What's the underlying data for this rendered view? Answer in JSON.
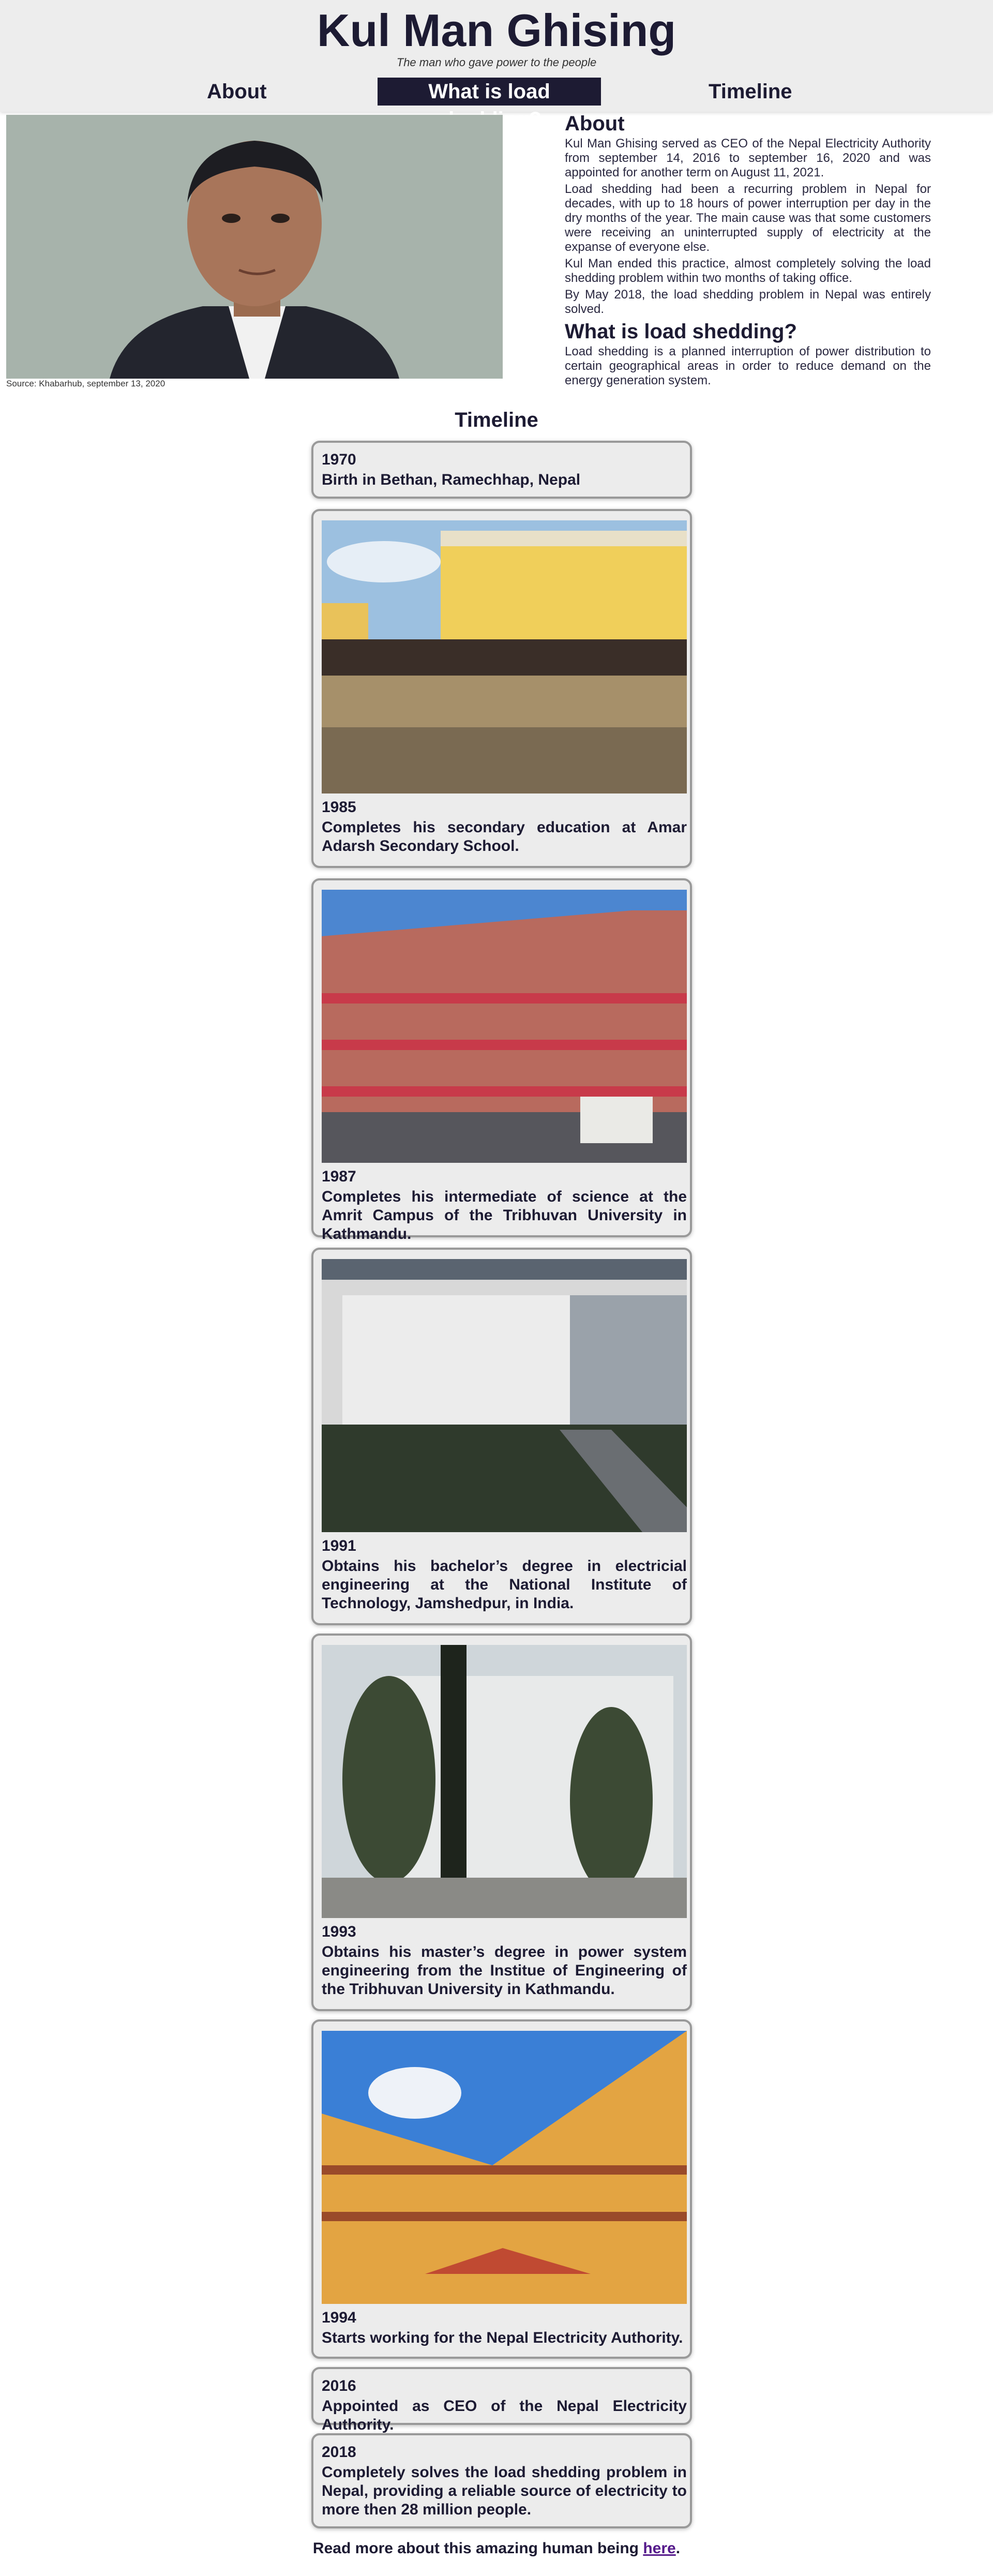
{
  "header": {
    "title": "Kul Man Ghising",
    "tagline": "The man who gave power to the people",
    "nav": [
      "About",
      "What is load shedding?",
      "Timeline"
    ]
  },
  "hero": {
    "caption": "Source: Khabarhub, september 13, 2020"
  },
  "about": {
    "heading": "About",
    "paragraphs": [
      "Kul Man Ghising served as CEO of the Nepal Electricity Authority from september 14, 2016 to september 16, 2020 and was appointed for another term on August 11, 2021.",
      "Load shedding had been a recurring problem in Nepal for decades, with up to 18 hours of power interruption per day in the dry months of the year. The main cause was that some customers were receiving an uninterrupted supply of electricity at the expanse of everyone else.",
      "Kul Man ended this practice, almost completely solving the load shedding problem within two months of taking office.",
      "By May 2018, the load shedding problem in Nepal was entirely solved."
    ],
    "load_heading": "What is load shedding?",
    "load_paragraph": "Load shedding is a planned interruption of power distribution to certain geographical areas in order to reduce demand on the energy generation system."
  },
  "timeline": {
    "title": "Timeline",
    "events": [
      {
        "year": "1970",
        "text": "Birth in Bethan, Ramechhap, Nepal"
      },
      {
        "year": "1985",
        "text": "Completes his secondary education at Amar Adarsh Secondary School."
      },
      {
        "year": "1987",
        "text": "Completes his intermediate of science at the Amrit Campus of the Tribhuvan University in Kathmandu."
      },
      {
        "year": "1991",
        "text": "Obtains his bachelor’s degree in electricial engineering at the National Institute of Technology, Jamshedpur, in India."
      },
      {
        "year": "1993",
        "text": "Obtains his master’s degree in power system engineering from the Institue of Engineering of the Tribhuvan University in Kathmandu."
      },
      {
        "year": "1994",
        "text": "Starts working for the Nepal Electricity Authority."
      },
      {
        "year": "2016",
        "text": "Appointed as CEO of the Nepal Electricity Authority."
      },
      {
        "year": "2018",
        "text": "Completely solves the load shedding problem in Nepal, providing a reliable source of electricity to more then 28 million people."
      }
    ]
  },
  "footer": {
    "text_before": "Read more about this amazing human being ",
    "link_label": "here",
    "text_after": "."
  }
}
